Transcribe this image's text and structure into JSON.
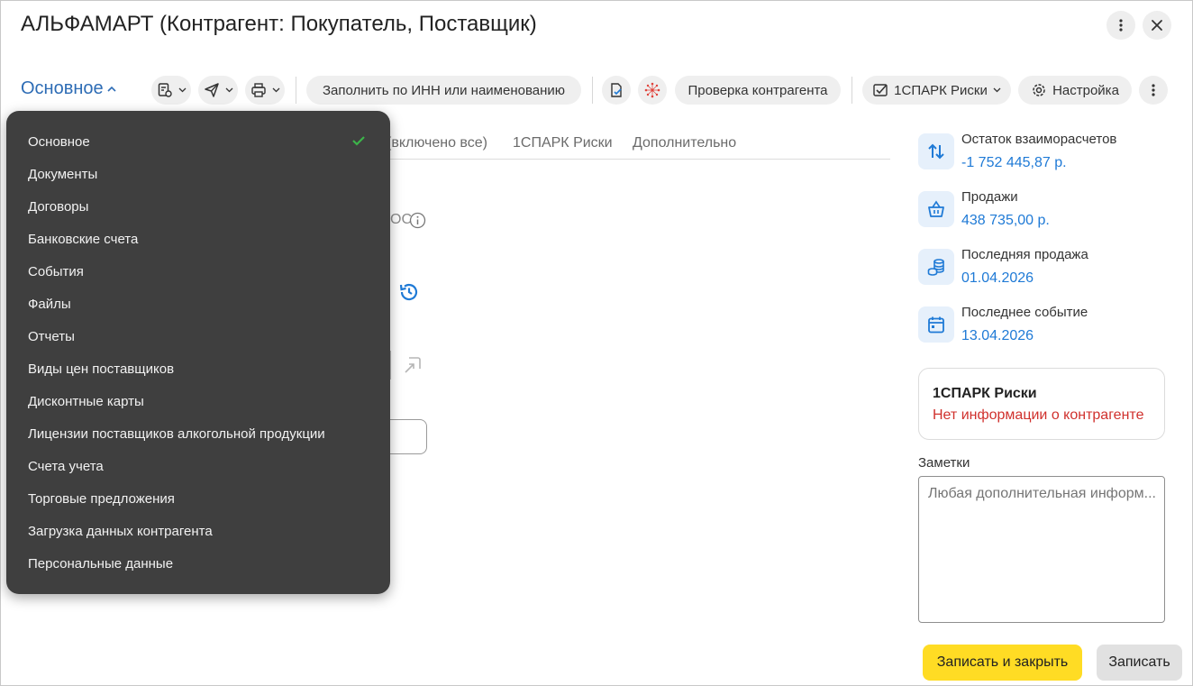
{
  "window": {
    "title": "АЛЬФАМАРТ (Контрагент: Покупатель, Поставщик)"
  },
  "toolbar": {
    "section_label": "Основное",
    "fill_by_inn_label": "Заполнить по ИНН или наименованию",
    "check_counterparty_label": "Проверка контрагента",
    "spark_risks_label": "1СПАРК Риски",
    "settings_label": "Настройка"
  },
  "tabs": [
    {
      "label": "(включено все)"
    },
    {
      "label": "1СПАРК Риски"
    },
    {
      "label": "Дополнительно"
    }
  ],
  "partial": {
    "obscured_text": "ОС"
  },
  "menu": {
    "items": [
      {
        "label": "Основное",
        "selected": true
      },
      {
        "label": "Документы"
      },
      {
        "label": "Договоры"
      },
      {
        "label": "Банковские счета"
      },
      {
        "label": "События"
      },
      {
        "label": "Файлы"
      },
      {
        "label": "Отчеты"
      },
      {
        "label": "Виды цен поставщиков"
      },
      {
        "label": "Дисконтные карты"
      },
      {
        "label": "Лицензии поставщиков алкогольной продукции"
      },
      {
        "label": "Счета учета"
      },
      {
        "label": "Торговые предложения"
      },
      {
        "label": "Загрузка данных контрагента"
      },
      {
        "label": "Персональные данные"
      }
    ]
  },
  "sidebar": {
    "balance": {
      "label": "Остаток взаиморасчетов",
      "value": "-1 752 445,87 р.",
      "icon": "arrows-up-down-icon"
    },
    "sales": {
      "label": "Продажи",
      "value": "438 735,00 р.",
      "icon": "basket-icon"
    },
    "last_sale": {
      "label": "Последняя продажа",
      "value": "01.04.2026",
      "icon": "coins-icon"
    },
    "last_event": {
      "label": "Последнее событие",
      "value": "13.04.2026",
      "icon": "calendar-icon"
    },
    "spark_card": {
      "title": "1СПАРК Риски",
      "message": "Нет информации о контрагенте"
    },
    "notes": {
      "label": "Заметки",
      "placeholder": "Любая дополнительная информ..."
    }
  },
  "footer": {
    "save_close_label": "Записать и закрыть",
    "save_label": "Записать"
  },
  "colors": {
    "accent_blue": "#1f7ad6",
    "section_blue": "#2d6cb5",
    "primary_button": "#ffdc24",
    "warning_red": "#d0312d",
    "menu_bg": "#3f3f3f",
    "check_green": "#3cb44a"
  }
}
